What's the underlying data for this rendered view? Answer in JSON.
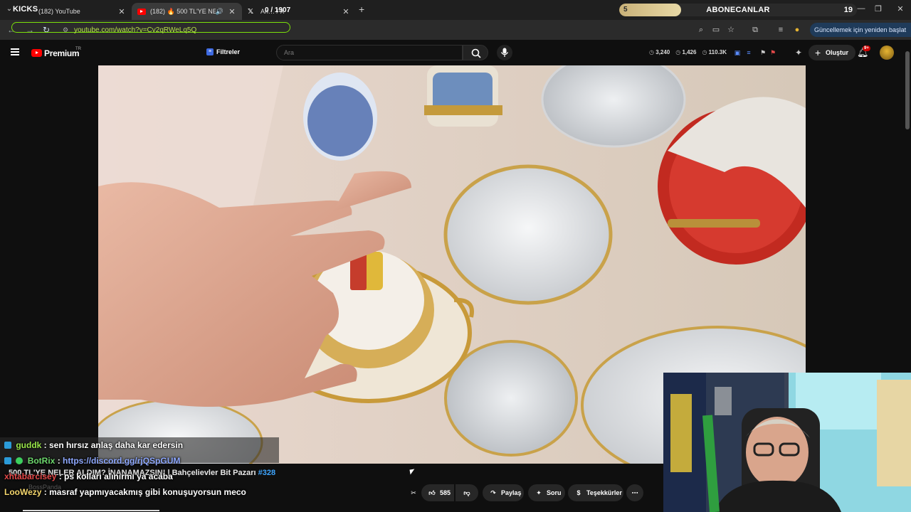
{
  "browser": {
    "overlay_title": "KICKS",
    "tabs": [
      {
        "title": "(182) YouTube",
        "active": false
      },
      {
        "title": "(182) 🔥 500 TL'YE NELER A",
        "active": true
      },
      {
        "title": "An… / X",
        "active": false
      }
    ],
    "tab_counter": "0 / 1907",
    "address_url": "youtube.com/watch?v=Cv2qRWeLq5Q",
    "update_label": "Güncellemek için yeniden başlat"
  },
  "subgoal": {
    "label": "ABONECANLAR",
    "current": "5",
    "target": "19",
    "progress": 0.26
  },
  "youtube": {
    "brand": "Premium",
    "region": "TR",
    "filters_label": "Filtreler",
    "search_placeholder": "Ara",
    "stats": [
      "3,240",
      "1,426",
      "110.3K"
    ],
    "create_label": "Oluştur",
    "notifications_badge": "9+"
  },
  "video": {
    "title": "500 TL'YE NELER ALDIM? İNANAMAZSIN! | Bahçelievler Bit Pazarı",
    "episode_tag": "#328",
    "likes": "585",
    "share_label": "Paylaş",
    "ask_label": "Soru",
    "thanks_label": "Teşekkürler"
  },
  "chat": {
    "messages": [
      {
        "user": "guddk",
        "text": " : sen hırsız anlaş daha kar edersin",
        "user_color": "#9ae64a"
      },
      {
        "user": "BotRix",
        "text": " : ",
        "link": "https://discord.gg/rjQSpGUM",
        "user_color": "#6cd76c"
      },
      {
        "user": "xhtabarcisey",
        "text": " : ps kolları alınırmı ya acaba",
        "user_color": "#e64a4a"
      },
      {
        "user": "LooWezy",
        "text": " : masraf yapmıyacakmış gibi konuşuyorsun meco",
        "user_color": "#f5d76e"
      }
    ],
    "faded_user": "BossPanda"
  },
  "colors": {
    "youtube_red": "#ff0000",
    "omnibox_outline": "#7ce00a",
    "link_blue": "#3ea6ff"
  }
}
